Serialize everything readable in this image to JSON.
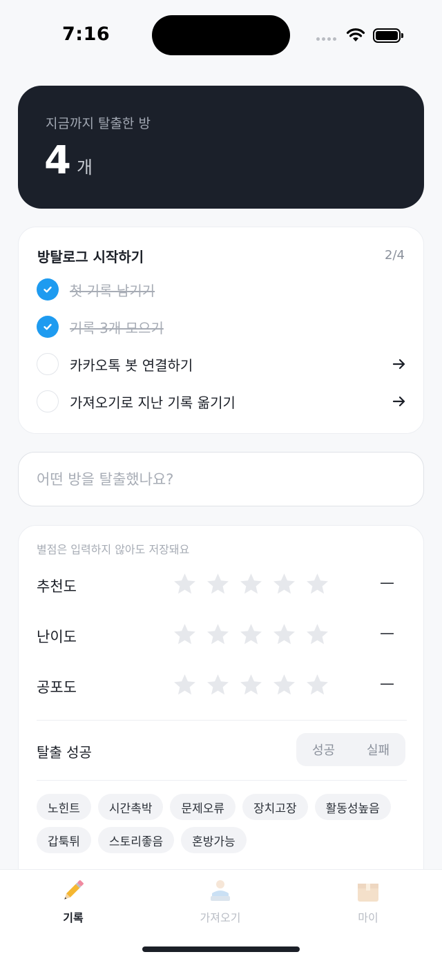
{
  "status_bar": {
    "time": "7:16"
  },
  "summary": {
    "label": "지금까지 탈출한 방",
    "count": "4",
    "unit": "개"
  },
  "onboarding": {
    "title": "방탈로그 시작하기",
    "progress": "2/4",
    "tasks": [
      {
        "label": "첫 기록 남기기",
        "done": true
      },
      {
        "label": "기록 3개 모으기",
        "done": true
      },
      {
        "label": "카카오톡 봇 연결하기",
        "done": false
      },
      {
        "label": "가져오기로 지난 기록 옮기기",
        "done": false
      }
    ]
  },
  "room_input": {
    "placeholder": "어떤 방을 탈출했나요?",
    "value": ""
  },
  "rating": {
    "hint": "별점은 입력하지 않아도 저장돼요",
    "rows": [
      {
        "label": "추천도",
        "stars": 0,
        "value": "—"
      },
      {
        "label": "난이도",
        "stars": 0,
        "value": "—"
      },
      {
        "label": "공포도",
        "stars": 0,
        "value": "—"
      }
    ],
    "star_empty_color": "#e6e8ec"
  },
  "escape": {
    "label": "탈출 성공",
    "options": [
      "성공",
      "실패"
    ]
  },
  "tags": [
    "노힌트",
    "시간촉박",
    "문제오류",
    "장치고장",
    "활동성높음",
    "갑툭튀",
    "스토리좋음",
    "혼방가능"
  ],
  "tab_bar": {
    "tabs": [
      {
        "label": "기록",
        "icon": "pencil-icon",
        "active": true
      },
      {
        "label": "가져오기",
        "icon": "import-icon",
        "active": false
      },
      {
        "label": "마이",
        "icon": "box-icon",
        "active": false
      }
    ]
  },
  "colors": {
    "accent": "#1e9bf0",
    "dark": "#1b202a",
    "background": "#f7f8fa"
  }
}
